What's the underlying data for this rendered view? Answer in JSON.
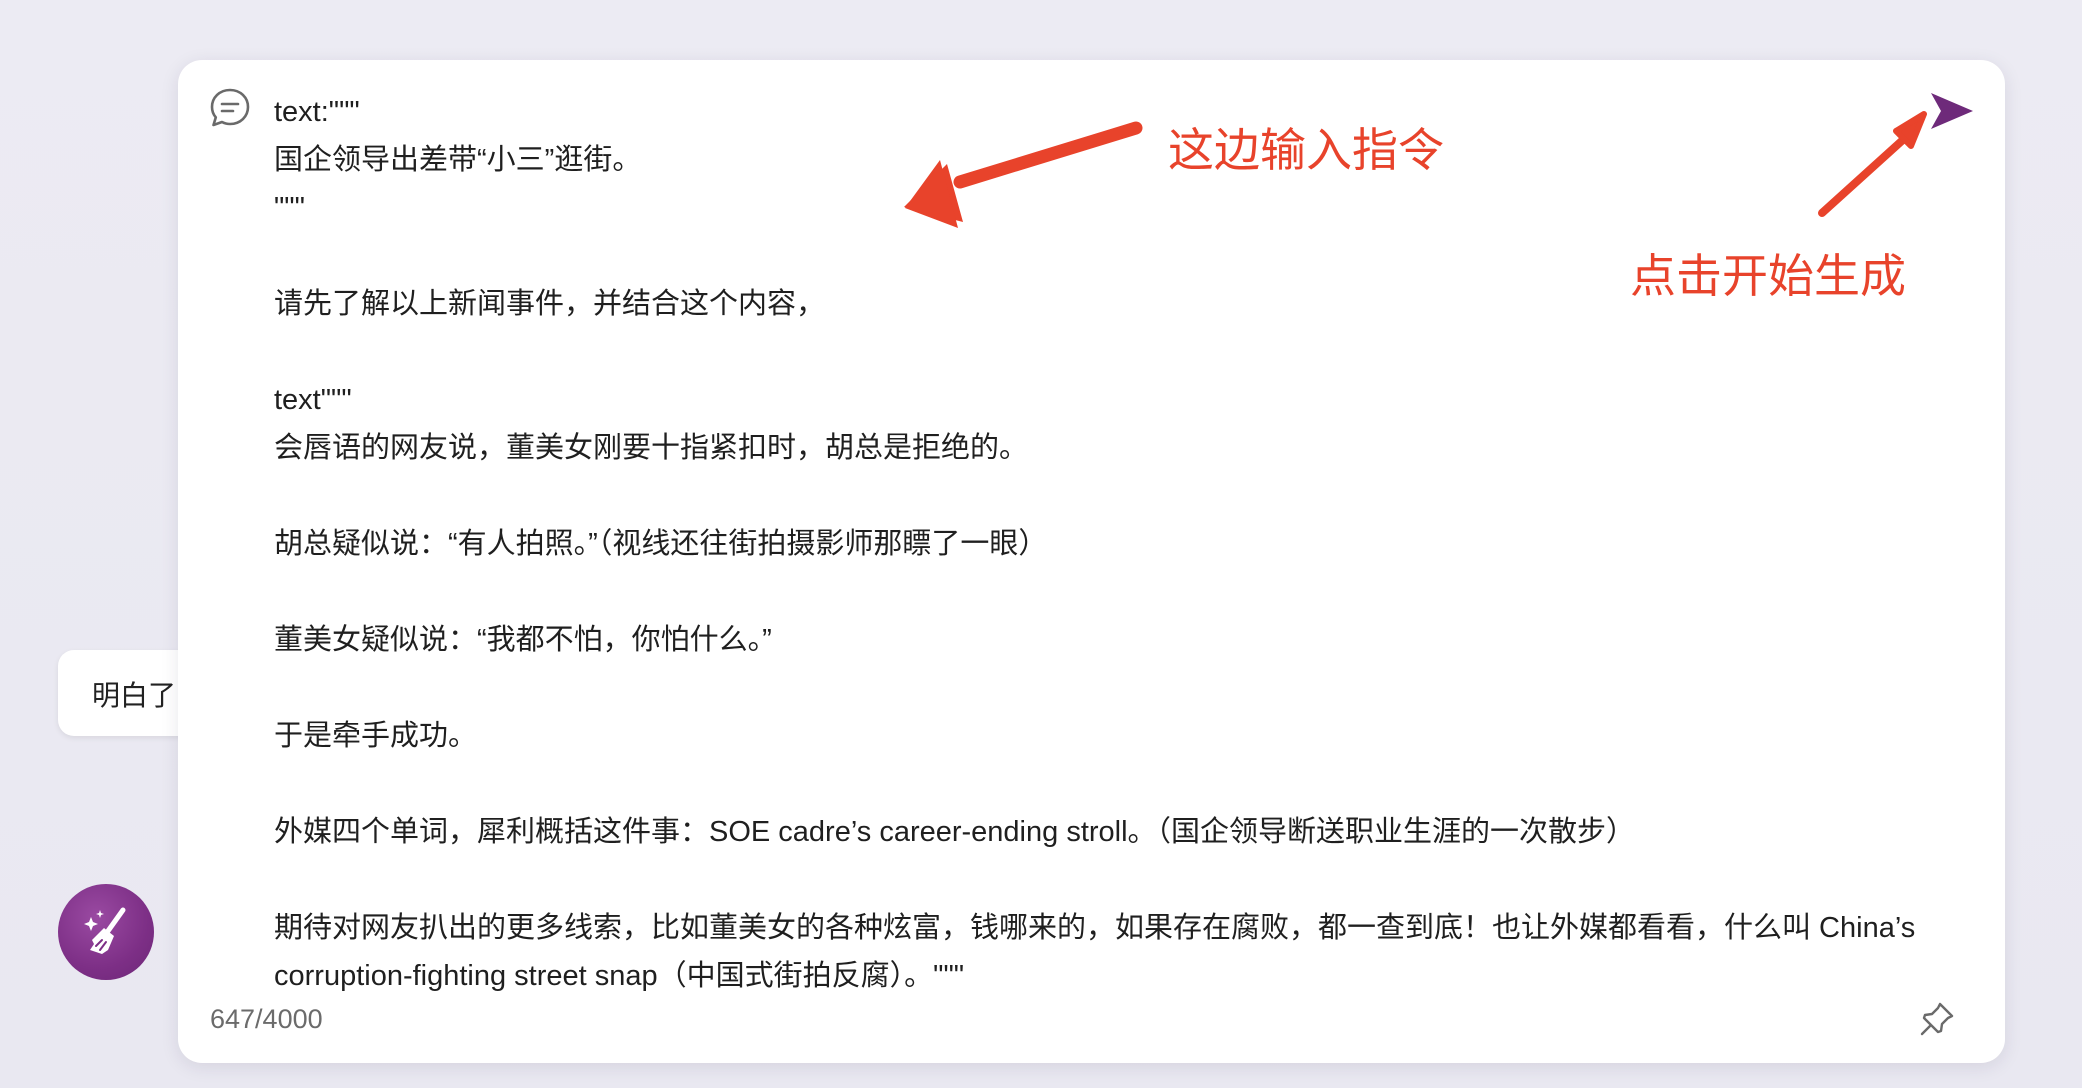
{
  "background_bubble": {
    "text": "明白了"
  },
  "composer": {
    "prompt_text": "text:\"\"\"\n国企领导出差带“小三”逛街。\n\"\"\"\n\n请先了解以上新闻事件，并结合这个内容，\n\ntext\"\"\"\n会唇语的网友说，董美女刚要十指紧扣时，胡总是拒绝的。\n\n胡总疑似说：“有人拍照。”（视线还往街拍摄影师那瞟了一眼）\n\n董美女疑似说：“我都不怕，你怕什么。”\n\n于是牵手成功。\n\n外媒四个单词，犀利概括这件事：SOE cadre’s career-ending stroll。（国企领导断送职业生涯的一次散步）\n\n期待对网友扒出的更多线索，比如董美女的各种炫富，钱哪来的，如果存在腐败，都一查到底！也让外媒都看看，什么叫 China’s corruption-fighting street snap（中国式街拍反腐）。\"\"\"",
    "char_count": "647/4000",
    "icons": {
      "chat": "chat-bubble-icon",
      "send": "send-icon",
      "pin": "pin-icon",
      "clear": "broom-icon"
    }
  },
  "annotations": {
    "input_hint": "这边输入指令",
    "send_hint": "点击开始生成"
  },
  "colors": {
    "accent_purple": "#7d2f86",
    "send_purple": "#6e2a7a",
    "annotation_red": "#e8432b",
    "page_background": "#ecebf3",
    "card_background": "#ffffff"
  }
}
